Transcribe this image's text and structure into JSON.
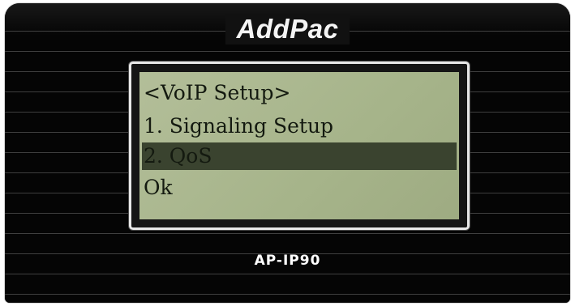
{
  "device": {
    "brand": "AddPac",
    "model": "AP-IP90"
  },
  "lcd": {
    "lines": [
      "<VoIP Setup>",
      "1. Signaling Setup",
      "2. QoS",
      "Ok"
    ],
    "selected_index": 2,
    "colors": {
      "screen": "#a8b58e",
      "highlight": "#3a432f",
      "text": "#141a10"
    }
  }
}
